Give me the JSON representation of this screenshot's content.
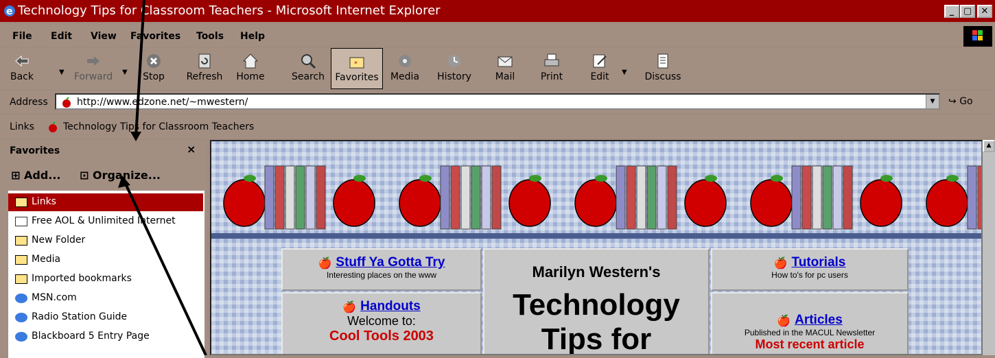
{
  "window": {
    "title": "Technology Tips for Classroom Teachers - Microsoft Internet Explorer"
  },
  "menu": [
    "File",
    "Edit",
    "View",
    "Favorites",
    "Tools",
    "Help"
  ],
  "toolbar": {
    "back": "Back",
    "forward": "Forward",
    "stop": "Stop",
    "refresh": "Refresh",
    "home": "Home",
    "search": "Search",
    "favorites": "Favorites",
    "media": "Media",
    "history": "History",
    "mail": "Mail",
    "print": "Print",
    "edit": "Edit",
    "discuss": "Discuss"
  },
  "address": {
    "label": "Address",
    "url": "http://www.edzone.net/~mwestern/",
    "go": "Go"
  },
  "links_bar": {
    "label": "Links",
    "item": "Technology Tips for Classroom Teachers"
  },
  "favorites_pane": {
    "title": "Favorites",
    "close": "×",
    "add": "Add...",
    "organize": "Organize...",
    "items": [
      {
        "label": "Links",
        "icon": "folder-icon",
        "selected": true
      },
      {
        "label": "Free AOL & Unlimited Internet",
        "icon": "page-icon",
        "selected": false
      },
      {
        "label": "New Folder",
        "icon": "folder-icon",
        "selected": false
      },
      {
        "label": "Media",
        "icon": "folder-icon",
        "selected": false
      },
      {
        "label": "Imported bookmarks",
        "icon": "folder-icon",
        "selected": false
      },
      {
        "label": "MSN.com",
        "icon": "ie-page-icon",
        "selected": false
      },
      {
        "label": "Radio Station Guide",
        "icon": "ie-page-icon",
        "selected": false
      },
      {
        "label": "Blackboard 5 Entry Page",
        "icon": "ie-page-icon",
        "selected": false
      }
    ]
  },
  "page": {
    "stuff": {
      "link": "Stuff Ya Gotta Try",
      "sub": "Interesting places on the www"
    },
    "handouts": {
      "link": "Handouts",
      "welcome": "Welcome to:",
      "event": "Cool Tools 2003"
    },
    "center": {
      "author": "Marilyn Western's",
      "line1": "Technology",
      "line2": "Tips for"
    },
    "tutorials": {
      "link": "Tutorials",
      "sub": "How to's for pc users"
    },
    "articles": {
      "link": "Articles",
      "sub": "Published in the MACUL Newsletter",
      "cut": "Most recent article"
    }
  },
  "colors": {
    "titlebar": "#9a0000",
    "chrome": "#a38f82",
    "selected": "#a80000",
    "link": "#0000cc"
  }
}
